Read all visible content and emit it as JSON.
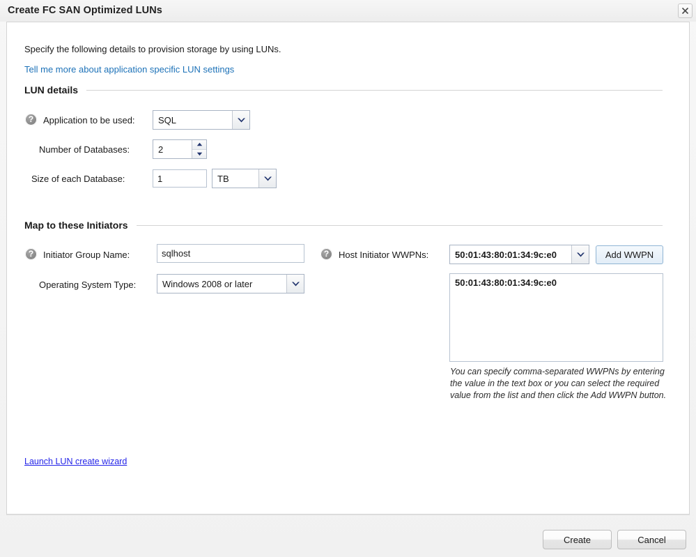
{
  "window": {
    "title": "Create FC SAN Optimized LUNs",
    "close_icon": "close-icon"
  },
  "intro": {
    "description": "Specify the following details to provision storage by using LUNs.",
    "link": "Tell me more about application specific LUN settings"
  },
  "lun_details": {
    "section_title": "LUN details",
    "application": {
      "label": "Application to be used:",
      "value": "SQL",
      "help_icon": "help-icon",
      "dropdown_icon": "chevron-down-icon"
    },
    "num_databases": {
      "label": "Number of Databases:",
      "value": "2",
      "increment_icon": "caret-up-icon",
      "decrement_icon": "caret-down-icon"
    },
    "size_each_database": {
      "label": "Size of each Database:",
      "value": "1",
      "unit": "TB",
      "dropdown_icon": "chevron-down-icon"
    }
  },
  "initiators": {
    "section_title": "Map to these Initiators",
    "group_name": {
      "label": "Initiator Group Name:",
      "value": "sqlhost",
      "help_icon": "help-icon"
    },
    "os_type": {
      "label": "Operating System Type:",
      "value": "Windows 2008 or later",
      "dropdown_icon": "chevron-down-icon"
    },
    "wwpns": {
      "label": "Host Initiator WWPNs:",
      "value": "50:01:43:80:01:34:9c:e0",
      "help_icon": "help-icon",
      "dropdown_icon": "chevron-down-icon",
      "add_button": "Add WWPN",
      "list": [
        "50:01:43:80:01:34:9c:e0"
      ],
      "hint": "You can specify comma-separated WWPNs by entering the value in the text box or you can select the required value from the list and then click the Add WWPN button."
    }
  },
  "wizard_link": "Launch LUN create wizard",
  "footer": {
    "create": "Create",
    "cancel": "Cancel"
  },
  "colors": {
    "link_blue": "#1d72b8",
    "wizard_link_blue": "#2424e8",
    "panel_bg": "#ffffff",
    "dialog_bg": "#f2f2f2",
    "accent_button": "#e2edf7"
  }
}
